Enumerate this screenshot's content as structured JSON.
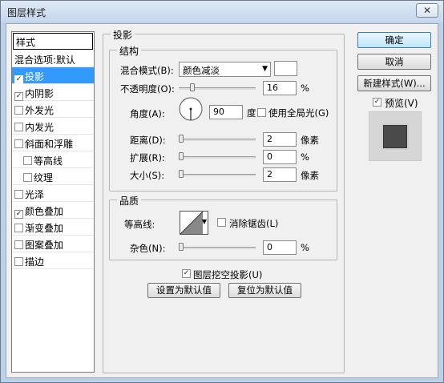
{
  "window": {
    "title": "图层样式",
    "close_glyph": "✕"
  },
  "styles_panel": {
    "header": "样式",
    "items": [
      {
        "label": "混合选项:默认",
        "checkbox": false,
        "checked": false,
        "selected": false,
        "indent": false
      },
      {
        "label": "投影",
        "checkbox": true,
        "checked": true,
        "selected": true,
        "indent": false
      },
      {
        "label": "内阴影",
        "checkbox": true,
        "checked": true,
        "selected": false,
        "indent": false
      },
      {
        "label": "外发光",
        "checkbox": true,
        "checked": false,
        "selected": false,
        "indent": false
      },
      {
        "label": "内发光",
        "checkbox": true,
        "checked": false,
        "selected": false,
        "indent": false
      },
      {
        "label": "斜面和浮雕",
        "checkbox": true,
        "checked": false,
        "selected": false,
        "indent": false
      },
      {
        "label": "等高线",
        "checkbox": true,
        "checked": false,
        "selected": false,
        "indent": true
      },
      {
        "label": "纹理",
        "checkbox": true,
        "checked": false,
        "selected": false,
        "indent": true
      },
      {
        "label": "光泽",
        "checkbox": true,
        "checked": false,
        "selected": false,
        "indent": false
      },
      {
        "label": "颜色叠加",
        "checkbox": true,
        "checked": true,
        "selected": false,
        "indent": false
      },
      {
        "label": "渐变叠加",
        "checkbox": true,
        "checked": false,
        "selected": false,
        "indent": false
      },
      {
        "label": "图案叠加",
        "checkbox": true,
        "checked": false,
        "selected": false,
        "indent": false
      },
      {
        "label": "描边",
        "checkbox": true,
        "checked": false,
        "selected": false,
        "indent": false
      }
    ]
  },
  "drop_shadow": {
    "title": "投影",
    "structure": {
      "title": "结构",
      "blend_mode_label": "混合模式(B):",
      "blend_mode_value": "颜色减淡",
      "color_swatch": "#ffffff",
      "opacity_label": "不透明度(O):",
      "opacity_value": "16",
      "opacity_unit": "%",
      "opacity_level": 0.16,
      "angle_label": "角度(A):",
      "angle_value": "90",
      "angle_unit": "度",
      "global_light_label": "使用全局光(G)",
      "global_light_checked": false,
      "distance_label": "距离(D):",
      "distance_value": "2",
      "distance_unit": "像素",
      "distance_level": 0.0,
      "spread_label": "扩展(R):",
      "spread_value": "0",
      "spread_unit": "%",
      "spread_level": 0.0,
      "size_label": "大小(S):",
      "size_value": "2",
      "size_unit": "像素",
      "size_level": 0.0
    },
    "quality": {
      "title": "品质",
      "contour_label": "等高线:",
      "anti_alias_label": "消除锯齿(L)",
      "anti_alias_checked": false,
      "noise_label": "杂色(N):",
      "noise_value": "0",
      "noise_unit": "%",
      "noise_level": 0.0
    },
    "knockout_label": "图层挖空投影(U)",
    "knockout_checked": true,
    "make_default_label": "设置为默认值",
    "reset_default_label": "复位为默认值"
  },
  "buttons": {
    "ok": "确定",
    "cancel": "取消",
    "new_style": "新建样式(W)...",
    "preview_label": "预览(V)",
    "preview_checked": true
  },
  "icons": {
    "checkbox_check": "✓",
    "dropdown_arrow": "▼"
  },
  "colors": {
    "selection": "#3399ff",
    "preview_swatch": "#4a4a4a"
  }
}
